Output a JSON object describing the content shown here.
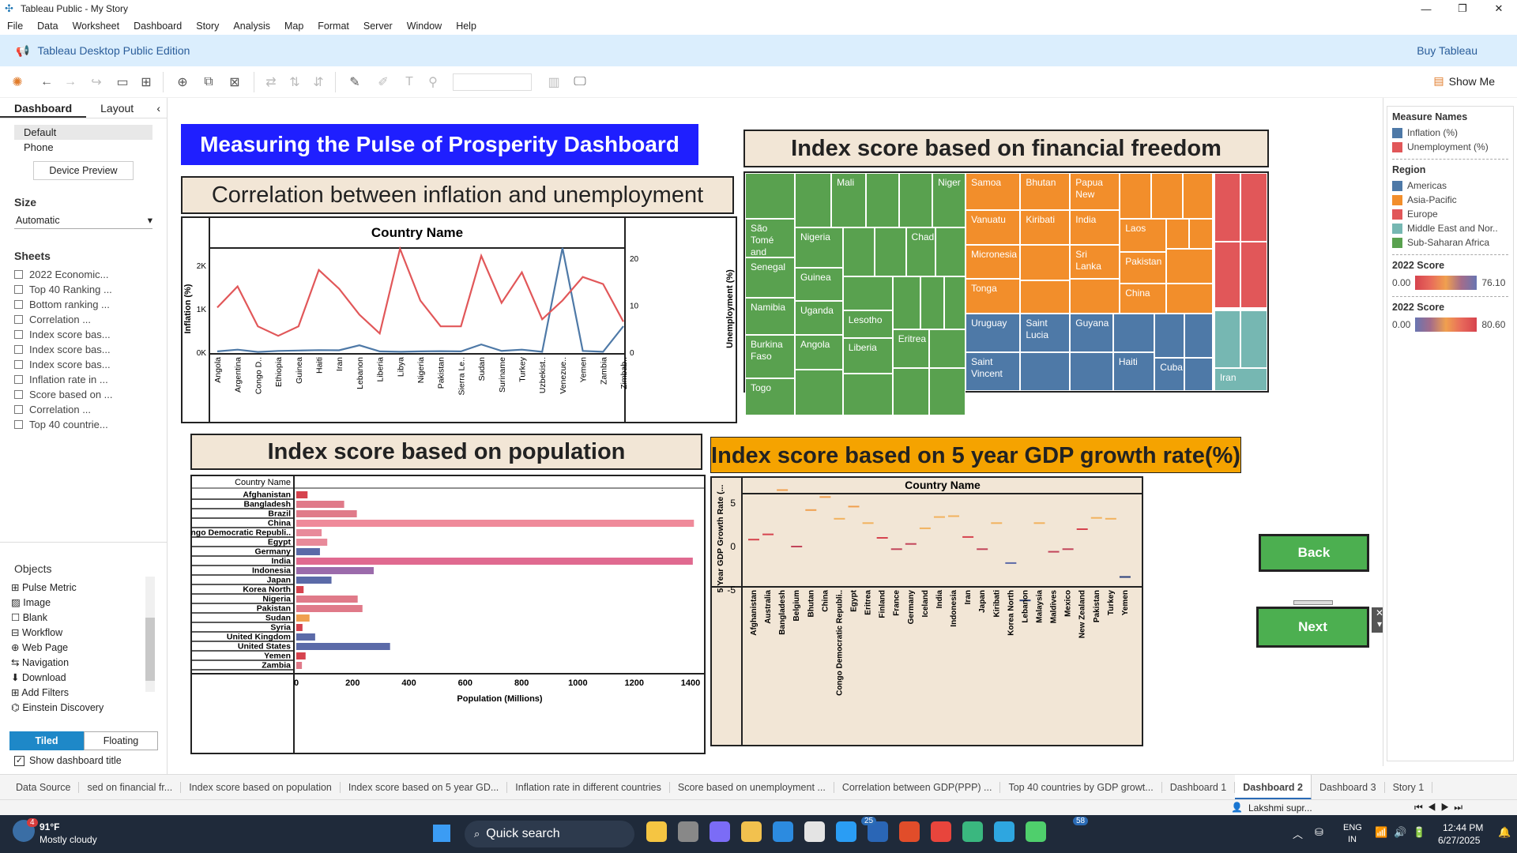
{
  "window": {
    "title": "Tableau Public - My Story"
  },
  "menu": [
    "File",
    "Data",
    "Worksheet",
    "Dashboard",
    "Story",
    "Analysis",
    "Map",
    "Format",
    "Server",
    "Window",
    "Help"
  ],
  "banner": {
    "edition": "Tableau Desktop Public Edition",
    "buy": "Buy Tableau"
  },
  "toolbar": {
    "show_me": "Show Me"
  },
  "leftpane": {
    "tabs": [
      "Dashboard",
      "Layout"
    ],
    "device": [
      "Default",
      "Phone"
    ],
    "device_preview": "Device Preview",
    "size_label": "Size",
    "size_value": "Automatic",
    "sheets_label": "Sheets",
    "sheets": [
      "2022 Economic...",
      "Top 40 Ranking ...",
      "Bottom ranking ...",
      "Correlation ...",
      "Index score bas...",
      "Index score bas...",
      "Index score bas...",
      "Inflation rate in ...",
      "Score based on ...",
      "Correlation ...",
      "Top 40 countrie..."
    ],
    "objects_label": "Objects",
    "objects": [
      "Pulse Metric",
      "Image",
      "Blank",
      "Workflow",
      "Web Page",
      "Navigation",
      "Download",
      "Add Filters",
      "Einstein Discovery"
    ],
    "tiled": "Tiled",
    "floating": "Floating",
    "show_title": "Show dashboard title"
  },
  "dashboard": {
    "main_title": "Measuring the Pulse of Prosperity Dashboard",
    "corr_title": "Correlation between inflation and unemployment",
    "fin_title": "Index score based on financial freedom",
    "pop_title": "Index score based on population",
    "gdp_title": "Index score based on 5 year GDP growth rate(%)",
    "back": "Back",
    "next": "Next"
  },
  "chart_data": [
    {
      "type": "line",
      "title": "Correlation between inflation and unemployment",
      "header": "Country Name",
      "ylabel": "Inflation (%)",
      "y2label": "Unemployment (%)",
      "y_ticks": [
        "0K",
        "1K",
        "2K"
      ],
      "y2_ticks": [
        "0",
        "10",
        "20"
      ],
      "categories": [
        "Angola",
        "Argentina",
        "Congo D..",
        "Ethiopia",
        "Guinea",
        "Haiti",
        "Iran",
        "Lebanon",
        "Liberia",
        "Libya",
        "Nigeria",
        "Pakistan",
        "Sierra Le..",
        "Sudan",
        "Suriname",
        "Turkey",
        "Uzbekist..",
        "Venezue..",
        "Yemen",
        "Zambia",
        "Zimbab.."
      ],
      "series": [
        {
          "name": "Inflation (%)",
          "color": "#4e79a7",
          "values": [
            20,
            60,
            8,
            30,
            40,
            50,
            45,
            160,
            20,
            10,
            20,
            25,
            20,
            180,
            30,
            60,
            10,
            2400,
            30,
            10,
            600
          ]
        },
        {
          "name": "Unemployment (%)",
          "color": "#e15759",
          "values": [
            9.5,
            14,
            5.5,
            3.5,
            5.5,
            17.5,
            13.5,
            8,
            4,
            22,
            11,
            5.5,
            5.5,
            20.5,
            10.5,
            17,
            7,
            11,
            16,
            14.5,
            6.5
          ]
        }
      ]
    },
    {
      "type": "treemap",
      "title": "Index score based on financial freedom",
      "legend": {
        "title": "Region",
        "items": [
          "Americas",
          "Asia-Pacific",
          "Europe",
          "Middle East and Nor..",
          "Sub-Saharan Africa"
        ]
      },
      "labels": [
        "Mali",
        "Niger",
        "São Tomé and",
        "Senegal",
        "Nigeria",
        "Chad",
        "Guinea",
        "Namibia",
        "Uganda",
        "Lesotho",
        "Burkina Faso",
        "Angola",
        "Liberia",
        "Eritrea",
        "Togo",
        "Samoa",
        "Bhutan",
        "Papua New",
        "Vanuatu",
        "Kiribati",
        "India",
        "Laos",
        "Micronesia",
        "Sri Lanka",
        "Pakistan",
        "Tonga",
        "China",
        "Uruguay",
        "Saint Lucia",
        "Guyana",
        "Haiti",
        "Saint Vincent",
        "Cuba",
        "Iran"
      ]
    },
    {
      "type": "bar",
      "title": "Index score based on population",
      "header": "Country Name",
      "xlabel": "Population (Millions)",
      "x_ticks": [
        "0",
        "200",
        "400",
        "600",
        "800",
        "1000",
        "1200",
        "1400"
      ],
      "categories": [
        "Afghanistan",
        "Bangladesh",
        "Brazil",
        "China",
        "Congo Democratic Republi..",
        "Egypt",
        "Germany",
        "India",
        "Indonesia",
        "Japan",
        "Korea North",
        "Nigeria",
        "Pakistan",
        "Sudan",
        "Syria",
        "United Kingdom",
        "United States",
        "Yemen",
        "Zambia"
      ],
      "values": [
        40,
        170,
        215,
        1412,
        90,
        110,
        84,
        1408,
        275,
        125,
        26,
        218,
        235,
        47,
        22,
        67,
        333,
        33,
        20
      ]
    },
    {
      "type": "scatter",
      "title": "Index score based on 5 year GDP growth rate(%)",
      "header": "Country Name",
      "ylabel": "5 Year GDP Growth Rate (...",
      "y_ticks": [
        "-5",
        "0",
        "5"
      ],
      "categories": [
        "Afghanistan",
        "Australia",
        "Bangladesh",
        "Belgium",
        "Bhutan",
        "China",
        "Congo Democratic Republi..",
        "Egypt",
        "Eritrea",
        "Finland",
        "France",
        "Germany",
        "Iceland",
        "India",
        "Indonesia",
        "Iran",
        "Japan",
        "Kiribati",
        "Korea North",
        "Lebanon",
        "Malaysia",
        "Maldives",
        "Mexico",
        "New Zealand",
        "Pakistan",
        "Turkey",
        "Yemen"
      ],
      "values": [
        0.8,
        1.4,
        6.5,
        0,
        4.2,
        5.7,
        3.2,
        4.6,
        2.7,
        1,
        -0.3,
        0.3,
        2.1,
        3.4,
        3.5,
        1.1,
        -0.3,
        2.7,
        -1.9,
        -6.2,
        2.7,
        -0.6,
        -0.3,
        2,
        3.3,
        3.2,
        -3.5
      ]
    }
  ],
  "legends": {
    "measure_title": "Measure Names",
    "measures": [
      "Inflation (%)",
      "Unemployment (%)"
    ],
    "score_title": "2022 Score",
    "score1": [
      "0.00",
      "76.10"
    ],
    "score2": [
      "0.00",
      "80.60"
    ]
  },
  "bottom_tabs": [
    "Data Source",
    "sed on financial fr...",
    "Index score based on population",
    "Index score based on 5 year GD...",
    "Inflation rate in different countries",
    "Score based on unemployment ...",
    "Correlation between GDP(PPP) ...",
    "Top 40 countries by GDP growt...",
    "Dashboard 1",
    "Dashboard 2",
    "Dashboard 3",
    "Story 1"
  ],
  "status": {
    "user": "Lakshmi supr..."
  },
  "taskbar": {
    "weather_temp": "91°F",
    "weather_desc": "Mostly cloudy",
    "search": "Quick search",
    "lang1": "ENG",
    "lang2": "IN",
    "time": "12:44 PM",
    "date": "6/27/2025",
    "badge1": "4",
    "badge2": "25",
    "badge3": "58"
  }
}
